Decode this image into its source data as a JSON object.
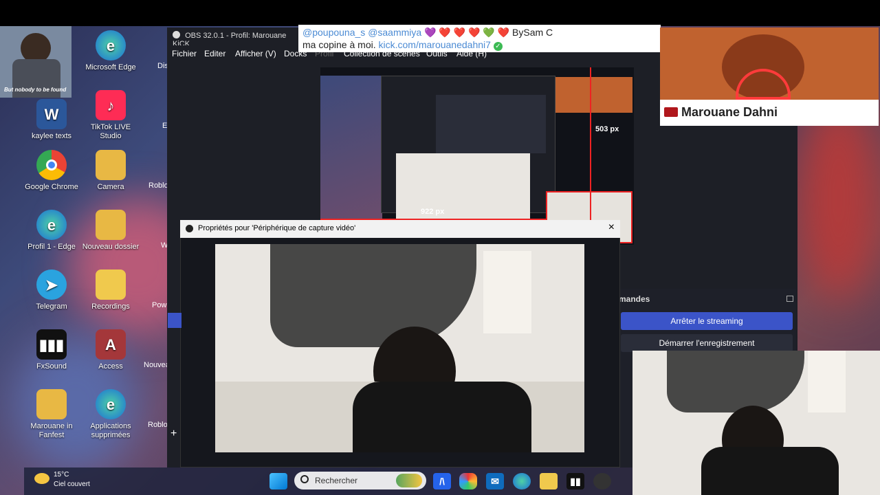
{
  "obs": {
    "title": "OBS 32.0.1 - Profil: Marouane KiCK",
    "menu": [
      "Fichier",
      "Editer",
      "Afficher (V)",
      "Docks",
      "Profil",
      "Collection de scènes",
      "Outils",
      "Aide (H)"
    ]
  },
  "properties_dialog": {
    "title": "Propriétés pour 'Périphérique de capture vidéo'",
    "close_label": "×"
  },
  "preview": {
    "width_label": "922 px",
    "height_label": "503 px"
  },
  "controls": {
    "header": "mandes",
    "stop_streaming": "Arrêter le streaming",
    "start_recording": "Démarrer l'enregistrement"
  },
  "banner": {
    "line1_user1": "@poupouna_s",
    "line1_user2": "@saammiya",
    "line1_suffix": "BySam C",
    "line2_text": "ma copine à moi.",
    "line2_link": "kick.com/marouanedahni7"
  },
  "nameplate": {
    "name": "Marouane Dahni"
  },
  "avatar": {
    "caption": "But nobody to be found"
  },
  "desktop_icons": [
    {
      "label": "Microsoft Edge",
      "icon": "edge-icon",
      "color": "#1aa0d8"
    },
    {
      "label": "kaylee texts",
      "icon": "word-icon",
      "color": "#2b579a"
    },
    {
      "label": "TikTok LIVE Studio",
      "icon": "tiktok-icon",
      "color": "#fe2c55"
    },
    {
      "label": "Google Chrome",
      "icon": "chrome-icon",
      "color": "#34a853"
    },
    {
      "label": "Camera",
      "icon": "folder-icon",
      "color": "#e8b844"
    },
    {
      "label": "Profil 1 - Edge",
      "icon": "edge-icon",
      "color": "#1aa0d8"
    },
    {
      "label": "Nouveau dossier",
      "icon": "folder-icon",
      "color": "#e8b844"
    },
    {
      "label": "Telegram",
      "icon": "telegram-icon",
      "color": "#2aa3df"
    },
    {
      "label": "Recordings",
      "icon": "folder-icon",
      "color": "#f0c94d"
    },
    {
      "label": "FxSound",
      "icon": "fxsound-icon",
      "color": "#111"
    },
    {
      "label": "Access",
      "icon": "access-icon",
      "color": "#a4373a"
    },
    {
      "label": "Marouane in Fanfest",
      "icon": "folder-icon",
      "color": "#e8b844"
    },
    {
      "label": "Applications supprimées",
      "icon": "edge-icon",
      "color": "#1aa0d8"
    }
  ],
  "partial_icons": [
    "Dis",
    "E",
    "Roblo",
    "W",
    "Pow",
    "Nouvea",
    "Roblo"
  ],
  "taskbar": {
    "weather_temp": "15°C",
    "weather_desc": "Ciel couvert",
    "search_placeholder": "Rechercher"
  }
}
